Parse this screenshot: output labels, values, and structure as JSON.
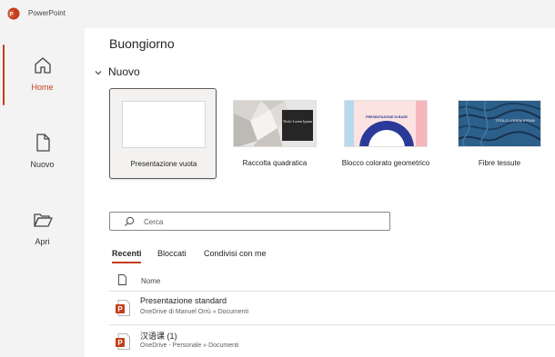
{
  "app": {
    "title": "PowerPoint",
    "brand_color": "#c43e1c"
  },
  "rail": {
    "items": [
      {
        "label": "Home",
        "icon": "home-icon",
        "active": true
      },
      {
        "label": "Nuovo",
        "icon": "new-file-icon",
        "active": false
      },
      {
        "label": "Apri",
        "icon": "open-folder-icon",
        "active": false
      }
    ]
  },
  "main": {
    "greeting": "Buongiorno",
    "new_section": {
      "title": "Nuovo",
      "templates": [
        {
          "label": "Presentazione vuota",
          "selected": true
        },
        {
          "label": "Raccolta quadratica",
          "thumb_text": "Titolo Lorem Ipsum"
        },
        {
          "label": "Blocco colorato geometrico",
          "thumb_text": "PRESENTAZIONE DI BASE"
        },
        {
          "label": "Fibre tessute",
          "thumb_text": "TITOLO LOREM IPSUM"
        }
      ]
    },
    "search": {
      "placeholder": "Cerca",
      "value": ""
    },
    "tabs": [
      {
        "label": "Recenti",
        "active": true
      },
      {
        "label": "Bloccati",
        "active": false
      },
      {
        "label": "Condivisi con me",
        "active": false
      }
    ],
    "list": {
      "column_name": "Nome",
      "files": [
        {
          "name": "Presentazione standard",
          "path": "OneDrive di Manuel Orrù » Documenti"
        },
        {
          "name": "汉语课 (1)",
          "path": "OneDrive - Personale » Documenti"
        }
      ]
    }
  }
}
